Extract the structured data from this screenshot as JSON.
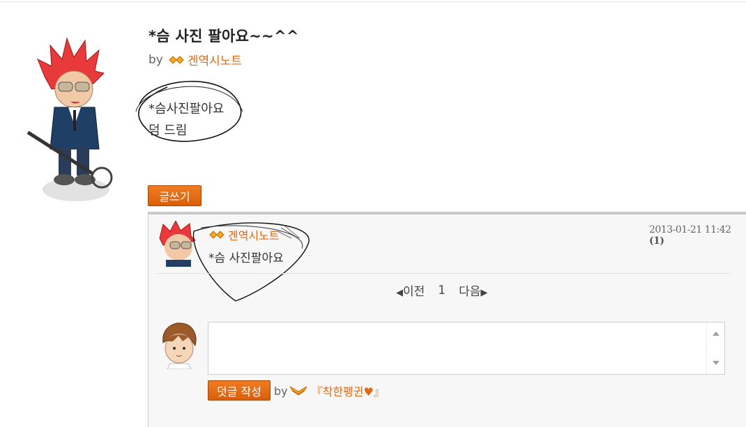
{
  "post": {
    "title": "*슴 사진 팔아요~~^^",
    "by_label": "by",
    "author": "겐역시노트",
    "body_line1": "*슴사진팔아요",
    "body_line2": "덤 드림"
  },
  "actions": {
    "write_label": "글쓰기"
  },
  "comments": [
    {
      "author": "겐역시노트",
      "text": "*슴 사진팔아요",
      "date": "2013-01-21 11:42",
      "count": "(1)"
    }
  ],
  "pager": {
    "prev_label": "이전",
    "page": "1",
    "next_label": "다음"
  },
  "comment_form": {
    "input_value": "",
    "submit_label": "덧글 작성",
    "by_label": "by",
    "user_name": "『착한펭귄♥』"
  },
  "colors": {
    "accent": "#e06a12",
    "button": "#e36a14",
    "panel_bg": "#f7f7f7"
  },
  "icons": {
    "gem": "orange-gem-icon",
    "wing": "orange-wing-icon",
    "prev": "triangle-left-icon",
    "next": "triangle-right-icon"
  }
}
